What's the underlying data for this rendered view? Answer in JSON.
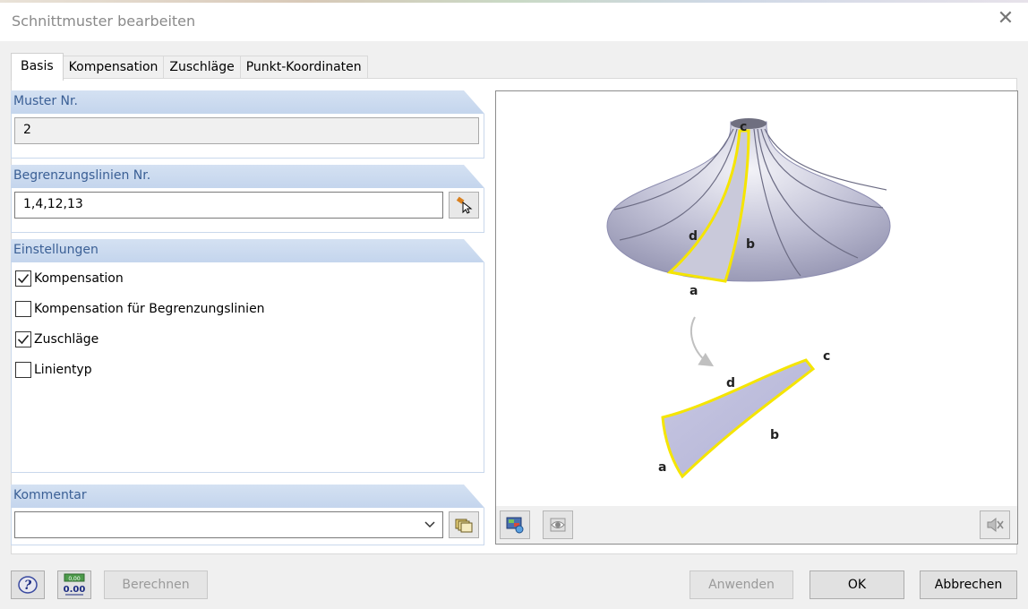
{
  "window": {
    "title": "Schnittmuster bearbeiten"
  },
  "tabs": [
    {
      "label": "Basis",
      "active": true
    },
    {
      "label": "Kompensation",
      "active": false
    },
    {
      "label": "Zuschläge",
      "active": false
    },
    {
      "label": "Punkt-Koordinaten",
      "active": false
    }
  ],
  "muster": {
    "header": "Muster Nr.",
    "value": "2"
  },
  "begrenzung": {
    "header": "Begrenzungslinien Nr.",
    "value": "1,4,12,13"
  },
  "einstellungen": {
    "header": "Einstellungen",
    "options": [
      {
        "label": "Kompensation",
        "checked": true
      },
      {
        "label": "Kompensation für Begrenzungslinien",
        "checked": false
      },
      {
        "label": "Zuschläge",
        "checked": true
      },
      {
        "label": "Linientyp",
        "checked": false
      }
    ]
  },
  "kommentar": {
    "header": "Kommentar",
    "value": ""
  },
  "figure": {
    "surface_labels": {
      "a": "a",
      "b": "b",
      "c": "c",
      "d": "d"
    },
    "pattern_labels": {
      "a": "a",
      "b": "b",
      "c": "c",
      "d": "d"
    }
  },
  "buttons": {
    "berechnen": "Berechnen",
    "anwenden": "Anwenden",
    "ok": "OK",
    "abbrechen": "Abbrechen",
    "units_top": "0,00",
    "units_bottom": "0.00"
  },
  "colors": {
    "accent": "#0078d7",
    "group_header": "#c9d8ee",
    "highlight": "#f5e500"
  }
}
